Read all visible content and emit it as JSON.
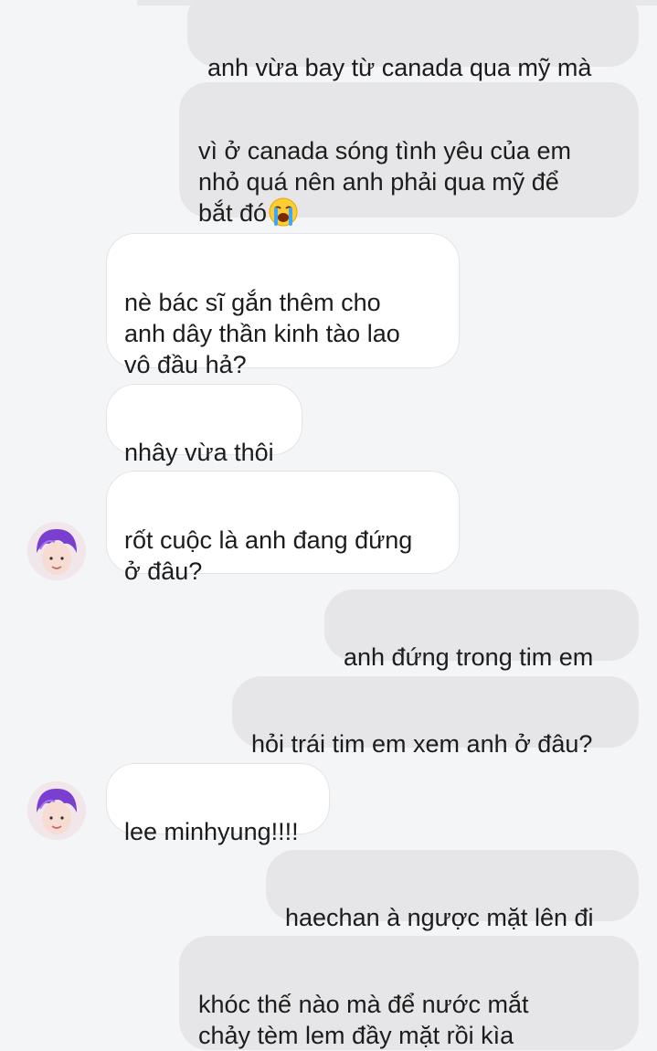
{
  "messages": [
    {
      "side": "out",
      "text": "anh vừa bay từ canada qua mỹ mà"
    },
    {
      "side": "out",
      "text": "vì ở canada sóng tình yêu của em\nnhỏ quá nên anh phải qua mỹ để\nbắt đó",
      "emoji": "loudly-crying-face-emoji"
    },
    {
      "side": "in",
      "text": "nè bác sĩ gắn thêm cho\nanh dây thần kinh tào lao\nvô đầu hả?"
    },
    {
      "side": "in",
      "text": "nhây vừa thôi"
    },
    {
      "side": "in",
      "text": "rốt cuộc là anh đang đứng\nở đâu?",
      "avatar": "contact-avatar"
    },
    {
      "side": "out",
      "text": "anh đứng trong tim em"
    },
    {
      "side": "out",
      "text": "hỏi trái tim em xem anh ở đâu?"
    },
    {
      "side": "in",
      "text": "lee minhyung!!!!",
      "avatar": "contact-avatar"
    },
    {
      "side": "out",
      "text": "haechan à ngược mặt lên đi"
    },
    {
      "side": "out",
      "text": "khóc thế nào mà để nước mắt\nchảy tèm lem đầy mặt rồi kìa"
    }
  ],
  "colors": {
    "background": "#f4f5f7",
    "outgoing_bubble": "#e6e6e8",
    "incoming_bubble": "#ffffff",
    "incoming_border": "#e3e4e8",
    "text": "#1c1c1c",
    "avatar_hair": "#7a3fd0"
  }
}
